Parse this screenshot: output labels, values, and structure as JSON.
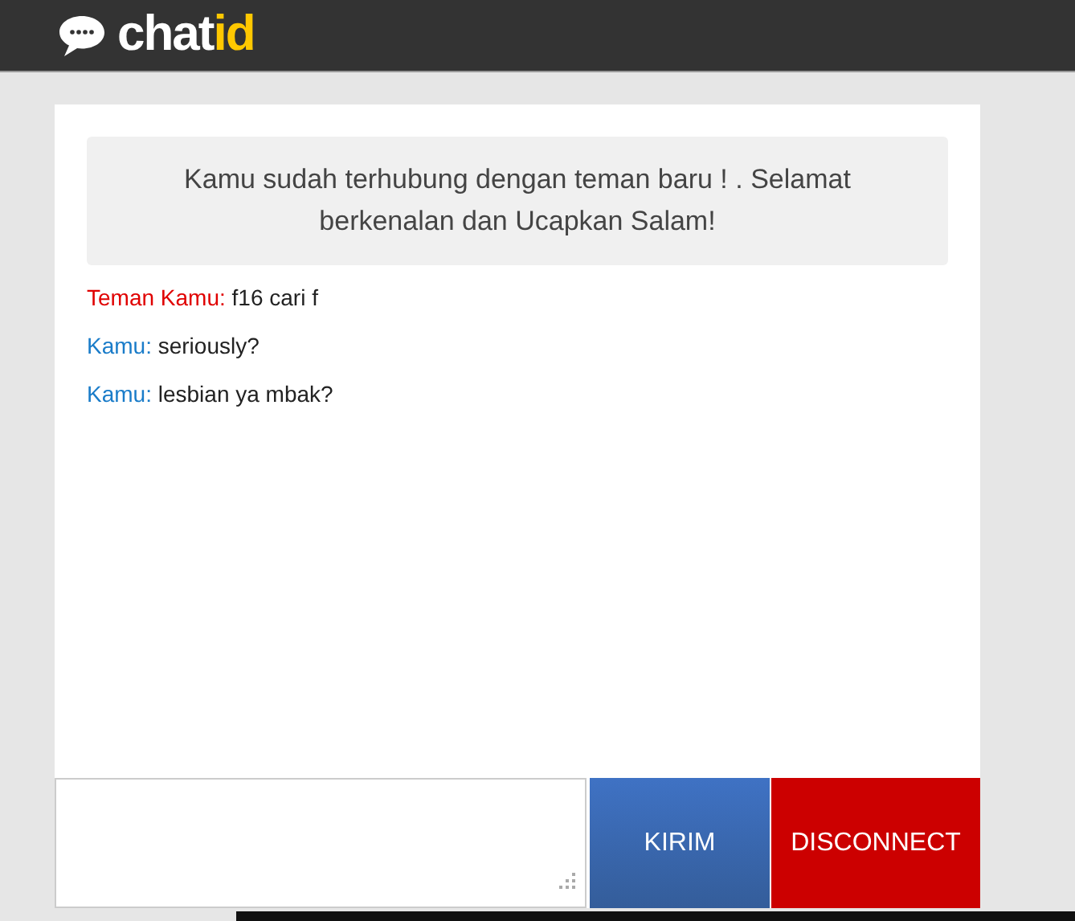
{
  "logo": {
    "text": "chat",
    "accent": "id"
  },
  "notice": "Kamu sudah terhubung dengan teman baru ! . Selamat berkenalan dan Ucapkan Salam!",
  "messages": [
    {
      "kind": "stranger",
      "sender": "Teman Kamu:",
      "text": "f16 cari f"
    },
    {
      "kind": "self",
      "sender": "Kamu:",
      "text": "seriously?"
    },
    {
      "kind": "self",
      "sender": "Kamu:",
      "text": "lesbian ya mbak?"
    }
  ],
  "buttons": {
    "send": "KIRIM",
    "disconnect": "DISCONNECT"
  }
}
